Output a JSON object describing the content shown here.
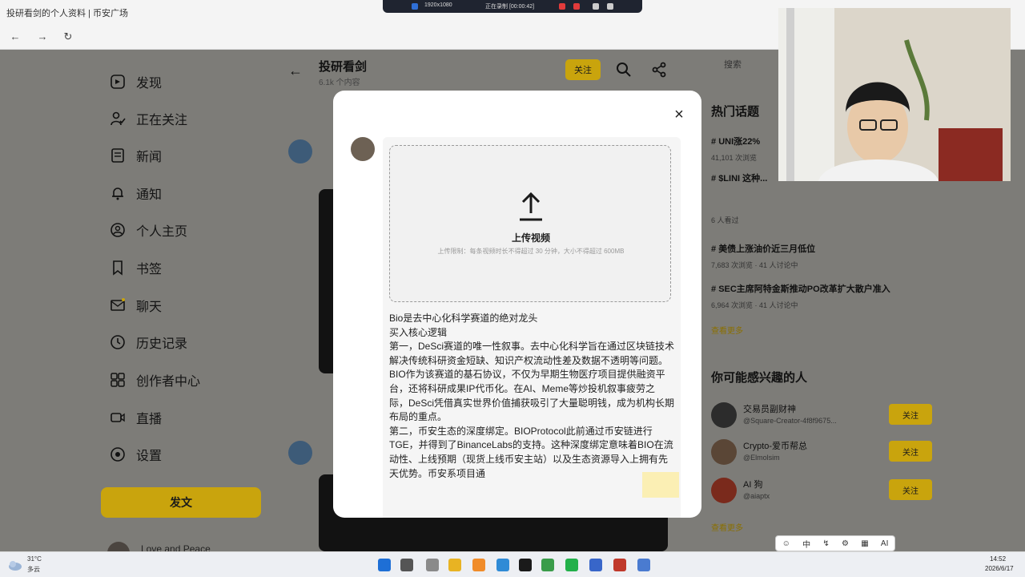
{
  "browser": {
    "tab_title": "投研看剑的个人资料 | 币安广场",
    "back": "←",
    "forward": "→",
    "reload": "↻",
    "recording": {
      "resolution": "1920x1080",
      "status": "正在录制 [00:00:42]"
    }
  },
  "sidebar": {
    "items": [
      {
        "label": "发现",
        "icon": "discover-icon"
      },
      {
        "label": "正在关注",
        "icon": "following-icon"
      },
      {
        "label": "新闻",
        "icon": "news-icon"
      },
      {
        "label": "通知",
        "icon": "bell-icon"
      },
      {
        "label": "个人主页",
        "icon": "profile-icon"
      },
      {
        "label": "书签",
        "icon": "bookmark-icon"
      },
      {
        "label": "聊天",
        "icon": "chat-icon"
      },
      {
        "label": "历史记录",
        "icon": "history-icon"
      },
      {
        "label": "创作者中心",
        "icon": "creator-center-icon"
      },
      {
        "label": "直播",
        "icon": "live-icon"
      },
      {
        "label": "设置",
        "icon": "settings-icon"
      }
    ],
    "post_button": "发文",
    "profile_name": "Love and Peace"
  },
  "main": {
    "title": "投研看剑",
    "subtitle": "6.1k 个内容",
    "follow_label": "关注"
  },
  "right": {
    "search_placeholder": "搜索",
    "hot_topics_heading": "热门话题",
    "topics": [
      {
        "title": "UNI涨22%",
        "meta": "41,101 次浏览"
      },
      {
        "title": "$LINI 这种...",
        "meta": "6 人看过"
      },
      {
        "title": "美债上涨油价近三月低位",
        "meta": "7,683 次浏览 · 41 人讨论中"
      },
      {
        "title": "SEC主席阿特金斯推动PO改革扩大散户准入",
        "meta": "6,964 次浏览 · 41 人讨论中"
      }
    ],
    "show_more": "查看更多",
    "people_heading": "你可能感兴趣的人",
    "people": [
      {
        "name": "交易员副财神",
        "handle": "@Square-Creator-4f8f9675...",
        "follow": "关注"
      },
      {
        "name": "Crypto-爱币帮总",
        "handle": "@Elmolsim",
        "follow": "关注"
      },
      {
        "name": "AI 狗",
        "handle": "@aiaptx",
        "follow": "关注"
      }
    ],
    "show_more_people": "查看更多"
  },
  "modal": {
    "close": "×",
    "upload_title": "上传视频",
    "upload_hint": "上传限制：每条视频时长不得超过 30 分钟，大小不得超过 600MB",
    "post_lines": [
      "Bio是去中心化科学赛道的绝对龙头",
      "买入核心逻辑",
      "第一，DeSci赛道的唯一性叙事。去中心化科学旨在通过区块链技术解决传统科研资金短缺、知识产权流动性差及数据不透明等问题。BIO作为该赛道的基石协议，不仅为早期生物医疗项目提供融资平台，还将科研成果IP代币化。在AI、Meme等炒投机叙事疲劳之际，DeSci凭借真实世界价值捕获吸引了大量聪明钱，成为机构长期布局的重点。",
      "第二，币安生态的深度绑定。BIOProtocol此前通过币安链进行TGE，并得到了BinanceLabs的支持。这种深度绑定意味着BIO在流动性、上线预期（现货上线币安主站）以及生态资源导入上拥有先天优势。币安系项目通"
    ]
  },
  "taskbar": {
    "weather_temp": "31°C",
    "weather_desc": "多云",
    "time": "14:52",
    "date": "2026/6/17",
    "input_method": "中",
    "float_ai": "AI"
  },
  "colors": {
    "accent": "#c9a40d",
    "overlay": "#7d7c78"
  }
}
